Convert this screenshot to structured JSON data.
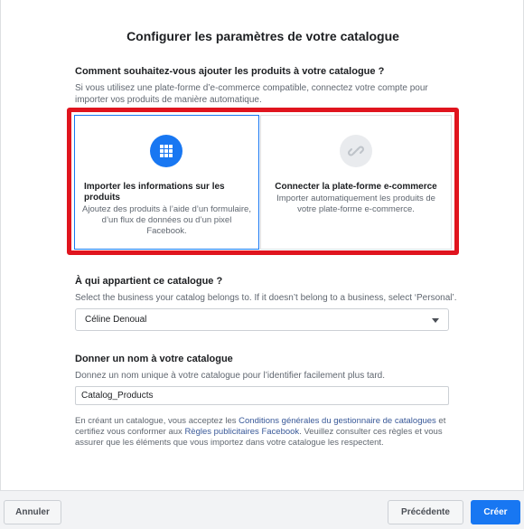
{
  "dialog": {
    "title": "Configurer les paramètres de votre catalogue"
  },
  "add_products": {
    "heading": "Comment souhaitez-vous ajouter les produits à votre catalogue ?",
    "helper_line1": "Si vous utilisez une plate-forme d’e-commerce compatible, connectez votre compte pour",
    "helper_line2": "importer vos produits de manière automatique.",
    "options": [
      {
        "icon": "grid-icon",
        "title": "Importer les informations sur les produits",
        "description": "Ajoutez des produits à l’aide d’un formulaire, d’un flux de données ou d’un pixel Facebook.",
        "selected": true
      },
      {
        "icon": "link-icon",
        "title": "Connecter la plate-forme e-commerce",
        "description": "Importer automatiquement les produits de votre plate-forme e-commerce.",
        "selected": false
      }
    ],
    "highlight_color": "#e0141e",
    "accent_color": "#1877f2"
  },
  "owner": {
    "heading": "À qui appartient ce catalogue ?",
    "helper": "Select the business your catalog belongs to. If it doesn’t belong to a business, select ‘Personal’.",
    "selected_value": "Céline Denoual"
  },
  "name": {
    "heading": "Donner un nom à votre catalogue",
    "helper": "Donnez un nom unique à votre catalogue pour l’identifier facilement plus tard.",
    "value": "Catalog_Products"
  },
  "legal": {
    "part1": "En créant un catalogue, vous acceptez les ",
    "link1": "Conditions générales du gestionnaire de catalogues",
    "part2": " et certifiez vous conformer aux ",
    "link2": "Règles publicitaires Facebook",
    "part3": ". Veuillez consulter ces règles et vous assurer que les éléments que vous importez dans votre catalogue les respectent."
  },
  "footer": {
    "cancel_label": "Annuler",
    "previous_label": "Précédente",
    "create_label": "Créer"
  }
}
